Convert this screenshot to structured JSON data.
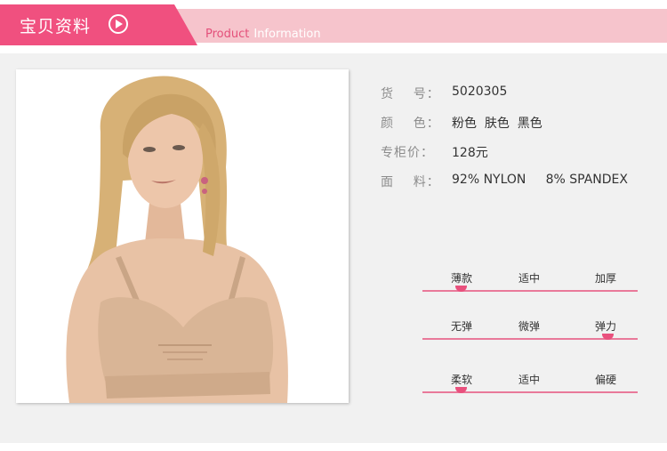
{
  "header": {
    "title": "宝贝资料",
    "subtitle_word1": "Product",
    "subtitle_word2": "Information",
    "icon": "play-circle-icon"
  },
  "specs": [
    {
      "label": "货    号：",
      "value": "5020305"
    },
    {
      "label": "颜    色：",
      "value": "粉色  肤色  黑色"
    },
    {
      "label": "专柜价：",
      "value": "128元"
    },
    {
      "label": "面    料：",
      "value": "92% NYLON     8% SPANDEX"
    }
  ],
  "scales": [
    {
      "left": "薄款",
      "middle": "适中",
      "right": "加厚",
      "level": 0.18
    },
    {
      "left": "无弹",
      "middle": "微弹",
      "right": "弹力",
      "level": 0.86
    },
    {
      "left": "柔软",
      "middle": "适中",
      "right": "偏硬",
      "level": 0.18
    }
  ],
  "colors": {
    "accent": "#f0507f",
    "header_band": "#f6c4cc",
    "scale_line": "#e9799a",
    "panel_bg": "#f1f1f1",
    "garment": "#d9b596"
  }
}
